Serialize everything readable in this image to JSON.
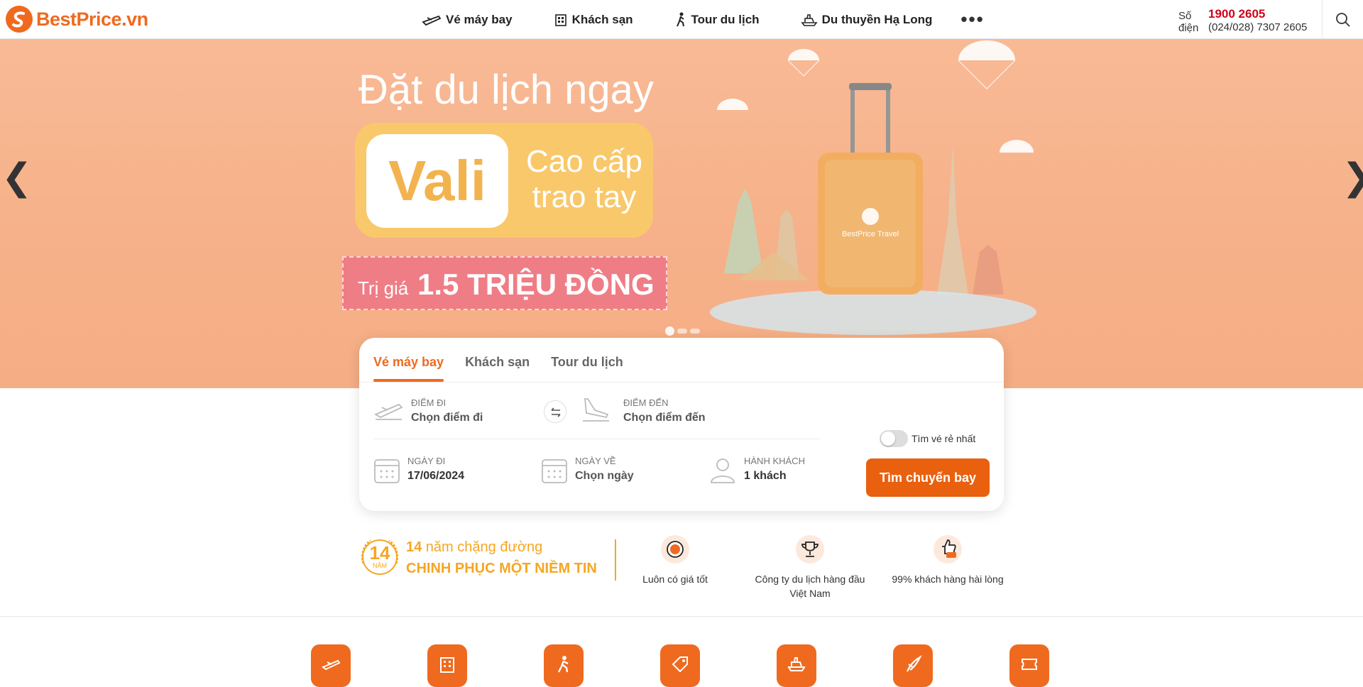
{
  "header": {
    "logo_text": "BestPrice.vn",
    "nav": [
      {
        "label": "Vé máy bay",
        "icon": "plane-icon"
      },
      {
        "label": "Khách sạn",
        "icon": "hotel-icon"
      },
      {
        "label": "Tour du lịch",
        "icon": "hiker-icon"
      },
      {
        "label": "Du thuyền Hạ Long",
        "icon": "cruise-icon"
      }
    ],
    "more_label": "•••",
    "contact_label": "Số điện",
    "phone_primary": "1900 2605",
    "phone_secondary": "(024/028) 7307 2605",
    "search_icon": "search-icon"
  },
  "banner": {
    "title": "Đặt du lịch ngay",
    "vali": "Vali",
    "vali_line1": "Cao cấp",
    "vali_line2": "trao tay",
    "price_prefix": "Trị giá",
    "price_value": "1.5 TRIỆU ĐỒNG",
    "arrow_prev": "❮",
    "arrow_next": "❯",
    "slides_total": 3,
    "slide_active": 1
  },
  "search": {
    "tabs": [
      "Vé máy bay",
      "Khách sạn",
      "Tour du lịch"
    ],
    "active_tab": "Vé máy bay",
    "from_label": "Điểm đi",
    "from_value": "Chọn điểm đi",
    "to_label": "Điểm đến",
    "to_value": "Chọn điểm đến",
    "depart_label": "Ngày đi",
    "depart_value": "17/06/2024",
    "return_label": "Ngày về",
    "return_value": "Chọn ngày",
    "pax_label": "Hành khách",
    "pax_value": "1 khách",
    "cheapest_label": "Tìm vé rẻ nhất",
    "cheapest_on": false,
    "submit_label": "Tìm chuyến bay"
  },
  "trust": {
    "badge_number": "14",
    "badge_unit": "NĂM",
    "years_number": "14",
    "years_text": " năm chặng đường",
    "slogan": "CHINH PHỤC MỘT NIỀM TIN",
    "features": [
      {
        "text": "Luôn có giá tốt",
        "icon": "price-tag-icon"
      },
      {
        "text": "Công ty du lịch hàng đầu Việt Nam",
        "icon": "trophy-icon"
      },
      {
        "text": "99% khách hàng hài lòng",
        "icon": "thumbs-up-icon"
      }
    ]
  },
  "categories": [
    {
      "icon": "plane-category-icon"
    },
    {
      "icon": "hotel-category-icon"
    },
    {
      "icon": "tour-category-icon"
    },
    {
      "icon": "ticket-category-icon"
    },
    {
      "icon": "cruise-category-icon"
    },
    {
      "icon": "flight-hotel-category-icon"
    },
    {
      "icon": "voucher-category-icon"
    }
  ],
  "colors": {
    "brand": "#ef6a1f",
    "phone": "#d0021b",
    "gold": "#f5a623",
    "banner_bg": "#f5a77a"
  }
}
